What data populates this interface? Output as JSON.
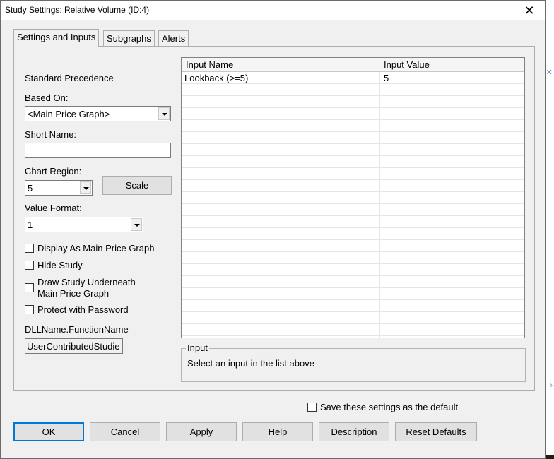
{
  "window": {
    "title": "Study Settings: Relative Volume (ID:4)",
    "close_symbol": "✕"
  },
  "tabs": [
    {
      "label": "Settings and Inputs",
      "active": true
    },
    {
      "label": "Subgraphs",
      "active": false
    },
    {
      "label": "Alerts",
      "active": false
    }
  ],
  "settings": {
    "standard_precedence": "Standard Precedence",
    "based_on_label": "Based On:",
    "based_on_value": "<Main Price Graph>",
    "short_name_label": "Short Name:",
    "short_name_value": "",
    "chart_region_label": "Chart Region:",
    "chart_region_value": "5",
    "scale_button": "Scale",
    "value_format_label": "Value Format:",
    "value_format_value": "1",
    "checkboxes": [
      {
        "label": "Display As Main Price Graph",
        "checked": false
      },
      {
        "label": "Hide Study",
        "checked": false
      },
      {
        "label_line1": "Draw Study Underneath",
        "label_line2": "Main Price Graph",
        "checked": false
      },
      {
        "label": "Protect with Password",
        "checked": false
      }
    ],
    "dll_label": "DLLName.FunctionName",
    "dll_value": "UserContributedStudie"
  },
  "inputs_table": {
    "columns": [
      "Input Name",
      "Input Value"
    ],
    "rows": [
      {
        "name": "Lookback (>=5)",
        "value": "5"
      }
    ]
  },
  "input_group": {
    "title": "Input",
    "text": "Select an input in the list above"
  },
  "footer": {
    "save_default_label": "Save these settings as the default",
    "save_default_checked": false,
    "buttons": {
      "ok": "OK",
      "cancel": "Cancel",
      "apply": "Apply",
      "help": "Help",
      "description": "Description",
      "reset": "Reset Defaults"
    }
  },
  "colors": {
    "dialog_bg": "#f0f0f0",
    "default_button_border": "#0078d7"
  }
}
